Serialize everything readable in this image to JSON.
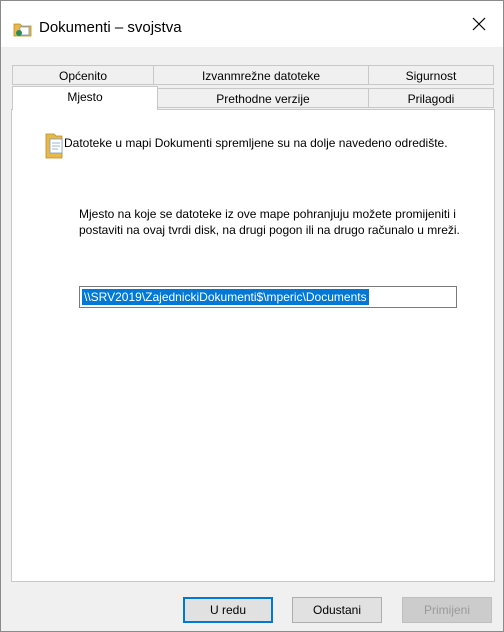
{
  "window": {
    "title": "Dokumenti – svojstva",
    "close_icon": "close-icon",
    "title_icon": "documents-folder-icon"
  },
  "tabs": {
    "row1": [
      "Općenito",
      "Izvanmrežne datoteke",
      "Sigurnost"
    ],
    "row2": [
      "Mjesto",
      "Prethodne verzije",
      "Prilagodi"
    ],
    "active": "Mjesto"
  },
  "location": {
    "info": "Datoteke u mapi Dokumenti spremljene su na dolje navedeno odredište.",
    "description": "Mjesto na koje se datoteke iz ove mape pohranjuju možete promijeniti i postaviti na ovaj tvrdi disk, na drugi pogon ili na drugo računalo u mreži.",
    "path": "\\\\SRV2019\\ZajednickiDokumenti$\\mperic\\Documents"
  },
  "buttons": {
    "ok": "U redu",
    "cancel": "Odustani",
    "apply": "Primijeni"
  },
  "colors": {
    "selection": "#0078d7",
    "folder": "#e8b84a"
  }
}
